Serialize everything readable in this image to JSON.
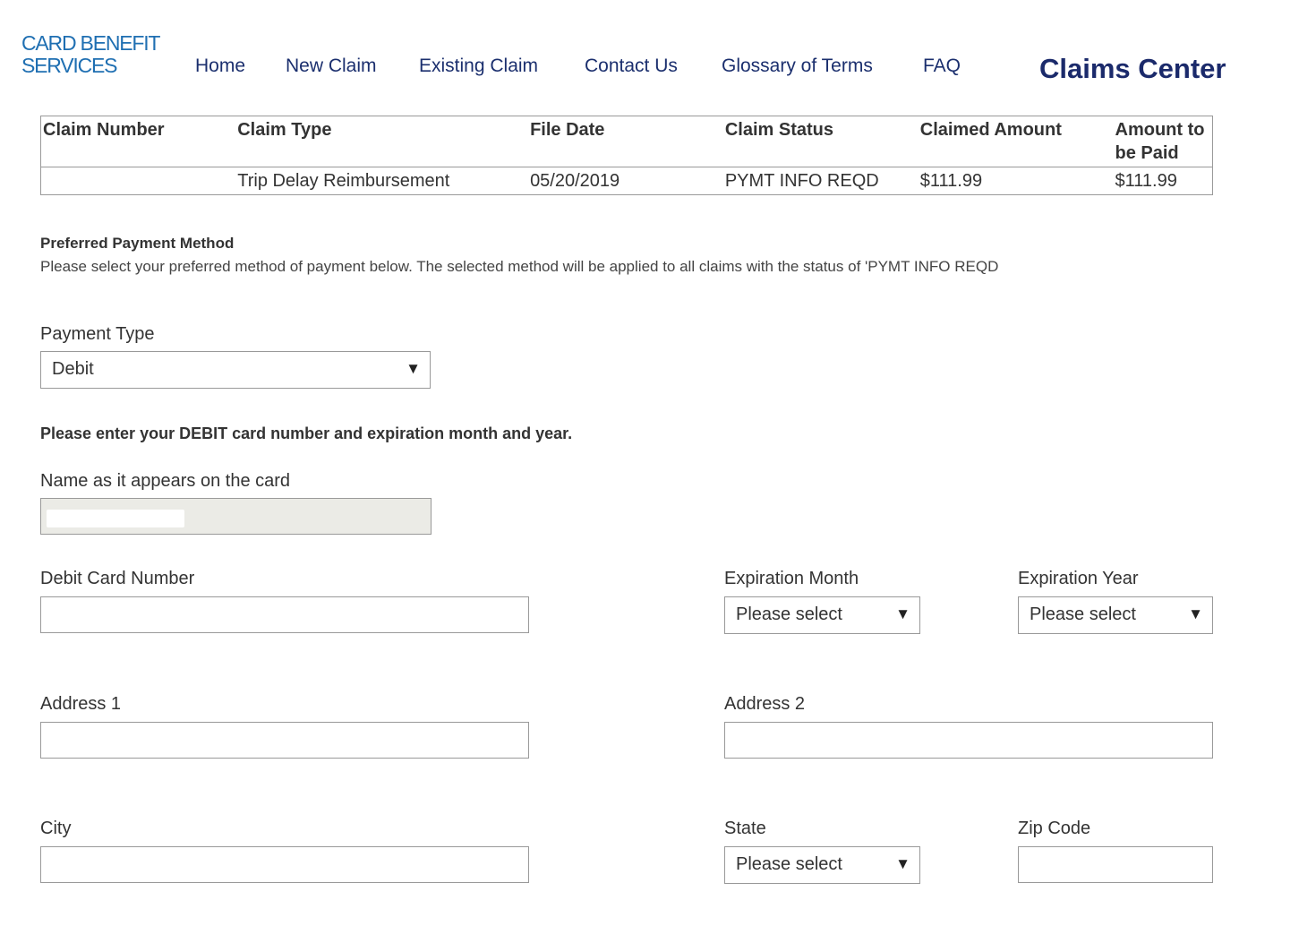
{
  "header": {
    "logo_line1": "CARD BENEFIT",
    "logo_line2": "SERVICES",
    "nav": [
      "Home",
      "New Claim",
      "Existing Claim",
      "Contact Us",
      "Glossary of Terms",
      "FAQ"
    ],
    "title": "Claims Center"
  },
  "claims_table": {
    "columns": [
      "Claim Number",
      "Claim Type",
      "File Date",
      "Claim Status",
      "Claimed Amount",
      "Amount to be Paid"
    ],
    "rows": [
      {
        "claim_number": "",
        "claim_type": "Trip Delay Reimbursement",
        "file_date": "05/20/2019",
        "claim_status": "PYMT INFO REQD",
        "claimed_amount": "$111.99",
        "amount_paid": "$111.99"
      }
    ]
  },
  "payment": {
    "title": "Preferred Payment Method",
    "description": "Please select your preferred method of payment below. The selected method will be applied to all claims with the status of 'PYMT INFO REQD",
    "payment_type_label": "Payment Type",
    "payment_type_value": "Debit",
    "instruction": "Please enter your DEBIT card number and expiration month and year."
  },
  "form": {
    "name_label": "Name as it appears on the card",
    "name_value": "",
    "card_number_label": "Debit Card Number",
    "exp_month_label": "Expiration Month",
    "exp_month_value": "Please select",
    "exp_year_label": "Expiration Year",
    "exp_year_value": "Please select",
    "address1_label": "Address 1",
    "address2_label": "Address 2",
    "city_label": "City",
    "state_label": "State",
    "state_value": "Please select",
    "zip_label": "Zip Code"
  },
  "colors": {
    "nav": "#1b2f6e",
    "title": "#1b2a6b",
    "logo": "#1f6fb2",
    "readonly_bg": "#ebebe6"
  },
  "icons": {
    "dropdown": "dropdown-arrow-icon"
  }
}
